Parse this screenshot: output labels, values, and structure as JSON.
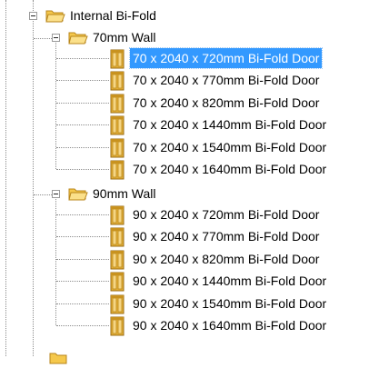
{
  "tree": {
    "root": {
      "label": "Internal Bi-Fold",
      "groups": [
        {
          "label": "70mm Wall",
          "items": [
            {
              "label": "70 x 2040 x 720mm Bi-Fold Door",
              "selected": true
            },
            {
              "label": "70 x 2040 x 770mm Bi-Fold Door",
              "selected": false
            },
            {
              "label": "70 x 2040 x 820mm Bi-Fold Door",
              "selected": false
            },
            {
              "label": "70 x 2040 x 1440mm Bi-Fold Door",
              "selected": false
            },
            {
              "label": "70 x 2040 x 1540mm Bi-Fold Door",
              "selected": false
            },
            {
              "label": "70 x 2040 x 1640mm Bi-Fold Door",
              "selected": false
            }
          ]
        },
        {
          "label": "90mm Wall",
          "items": [
            {
              "label": "90 x 2040 x 720mm Bi-Fold Door",
              "selected": false
            },
            {
              "label": "90 x 2040 x 770mm Bi-Fold Door",
              "selected": false
            },
            {
              "label": "90 x 2040 x 820mm Bi-Fold Door",
              "selected": false
            },
            {
              "label": "90 x 2040 x 1440mm Bi-Fold Door",
              "selected": false
            },
            {
              "label": "90 x 2040 x 1540mm Bi-Fold Door",
              "selected": false
            },
            {
              "label": "90 x 2040 x 1640mm Bi-Fold Door",
              "selected": false
            }
          ]
        }
      ]
    },
    "icons": {
      "folder": "open-folder-icon",
      "item": "bi-fold-door-icon",
      "expander": "collapse-icon"
    },
    "colors": {
      "selection": "#3399ff",
      "folder": "#f5c84c",
      "door": "#e8b43a"
    }
  }
}
